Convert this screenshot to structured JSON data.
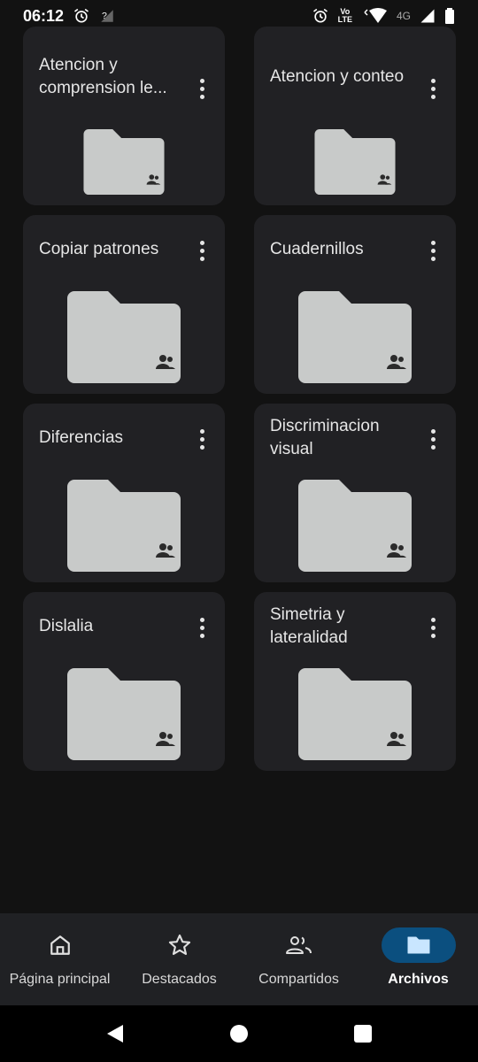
{
  "status_bar": {
    "time": "06:12",
    "volte_top": "Vo",
    "volte_bottom": "LTE",
    "network": "4G"
  },
  "folders": [
    {
      "title": "Atencion y comprension le..."
    },
    {
      "title": "Atencion y conteo"
    },
    {
      "title": "Copiar patrones"
    },
    {
      "title": "Cuadernillos"
    },
    {
      "title": "Diferencias"
    },
    {
      "title": "Discriminacion visual"
    },
    {
      "title": "Dislalia"
    },
    {
      "title": "Simetria y lateralidad"
    }
  ],
  "bottom_nav": {
    "items": [
      {
        "label": "Página principal",
        "icon": "home-icon",
        "active": false
      },
      {
        "label": "Destacados",
        "icon": "star-icon",
        "active": false
      },
      {
        "label": "Compartidos",
        "icon": "people-icon",
        "active": false
      },
      {
        "label": "Archivos",
        "icon": "folder-icon",
        "active": true
      }
    ]
  },
  "colors": {
    "background": "#121212",
    "card": "#212124",
    "folder": "#c8cac9",
    "active_pill": "#0b4f7f"
  }
}
